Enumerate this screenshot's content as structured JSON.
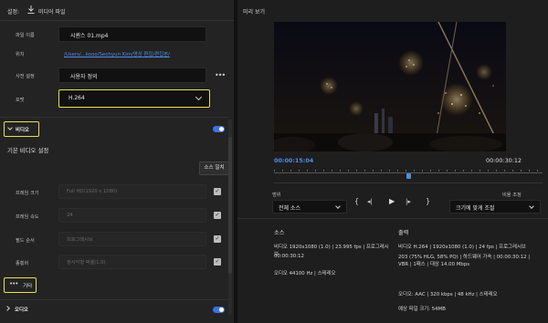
{
  "header": {
    "settings_label": "설정:",
    "media_file_label": "미디어 파일"
  },
  "form": {
    "filename_label": "파일 이름",
    "filename_value": "시퀀스 01.mp4",
    "location_label": "위치",
    "location_value": "/Users/...kooo/Seohyun Kim/영상 편집/편집본/",
    "preset_label": "사전 설정",
    "preset_value": "사용자 정의",
    "format_label": "포맷",
    "format_value": "H.264"
  },
  "video": {
    "section_label": "비디오",
    "basic_settings_title": "기본 비디오 설정",
    "match_source_button": "소스 일치",
    "rows": [
      {
        "label": "프레임 크기",
        "value": "Full HD(1920 x 1080)"
      },
      {
        "label": "프레임 속도",
        "value": "24"
      },
      {
        "label": "필드 순서",
        "value": "프로그레시브"
      },
      {
        "label": "종횡비",
        "value": "정사각형 픽셀(1.0)"
      }
    ],
    "more_button": "기타"
  },
  "audio": {
    "section_label": "오디오"
  },
  "preview": {
    "title": "미리 보기",
    "timecode_current": "00:00:15:04",
    "timecode_total": "00:00:30:12",
    "range_label": "범위",
    "range_value": "전체 소스",
    "scale_label": "비율 조정",
    "scale_value": "크기에 맞게 조절",
    "playhead_fraction": 0.5
  },
  "source_info": {
    "title": "소스",
    "lines": [
      "비디오 1920x1080 (1.0) | 23.995 fps | 프로그레시브",
      "00:00:30:12",
      "오디오 44100 Hz | 스테레오"
    ]
  },
  "output_info": {
    "title": "출력",
    "lines": [
      "비디오 H.264 | 1920x1080 (1.0) | 24 fps | 프로그레시브",
      "203 (75% HLG, 58% PQ) | 하드웨어 가속 | 00:00:30:12 | VBR | 1패스 | 대상 14.00 Mbps",
      "오디오: AAC | 320 kbps | 48 kHz | 스테레오",
      "예상 파일 크기: 54MB"
    ]
  },
  "colors": {
    "accent": "#3f72e0",
    "highlight": "#e8e24a",
    "timecode": "#4f8de8"
  }
}
